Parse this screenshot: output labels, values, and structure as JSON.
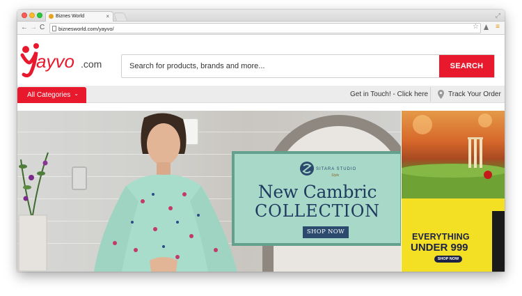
{
  "browser": {
    "tab_title": "Biznes World",
    "tab_close": "×",
    "url": "biznesworld.com/yayvo/",
    "nav_back": "←",
    "nav_forward": "→",
    "nav_reload": "C",
    "star": "☆",
    "menu": "≡",
    "fullscreen": "⤢"
  },
  "header": {
    "logo_text": "yayvo.com",
    "search": {
      "placeholder": "Search for products, brands and more...",
      "button_label": "SEARCH"
    }
  },
  "catbar": {
    "categories_label": "All Categories",
    "chevron": "⌄",
    "get_in_touch": "Get in Touch! - Click here",
    "track_order": "Track Your Order"
  },
  "main_banner": {
    "brand_name": "SITARA STUDIO",
    "brand_sub": "Style",
    "headline_1": "New Cambric",
    "headline_2": "COLLECTION",
    "cta": "SHOP NOW"
  },
  "side_banner": {
    "line1": "EVERYTHING",
    "line2": "UNDER 999",
    "cta": "SHOP NOW"
  },
  "colors": {
    "brand_red": "#e8192c",
    "promo_teal": "#a8d8c8",
    "promo_navy": "#1f3a5f",
    "side_yellow": "#f3df24"
  },
  "icons": [
    "page-icon",
    "star-icon",
    "extension-icon",
    "menu-icon",
    "chevron-down-icon",
    "location-pin-icon"
  ]
}
